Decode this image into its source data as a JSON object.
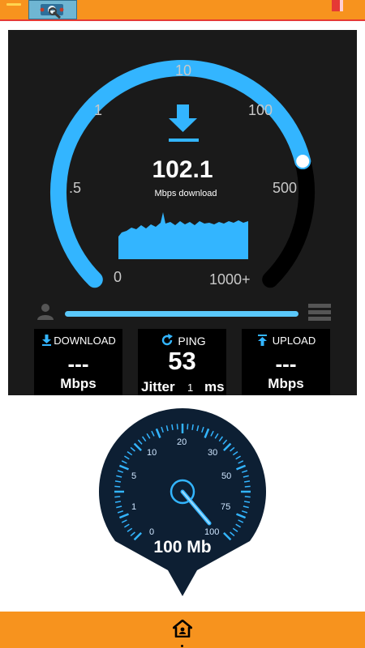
{
  "app": {
    "exit_icon": "exit-door-icon",
    "menu_icon": "menu-icon",
    "logo_icon": "speedtest-logo"
  },
  "colors": {
    "accent_orange": "#f7931e",
    "accent_blue": "#33b5ff",
    "panel_bg": "#1a1a1a",
    "gauge_bg": "#0d1f33"
  },
  "meter": {
    "speed": "102.1",
    "unit_label": "Mbps download",
    "scale_labels": [
      "0",
      ".5",
      "1",
      "10",
      "100",
      "500",
      "1000+"
    ],
    "progress_fraction": 0.78
  },
  "cards": {
    "download": {
      "title": "DOWNLOAD",
      "value": "---",
      "unit": "Mbps"
    },
    "ping": {
      "title": "PING",
      "value": "53",
      "jitter_label": "Jitter",
      "jitter_value": "1",
      "jitter_unit": "ms"
    },
    "upload": {
      "title": "UPLOAD",
      "value": "---",
      "unit": "Mbps"
    }
  },
  "gauge": {
    "labels": [
      "0",
      "1",
      "5",
      "10",
      "20",
      "30",
      "50",
      "75",
      "100"
    ],
    "readout": "100 Mb",
    "needle_value": 100
  },
  "bottom_nav": {
    "home_icon": "home-icon"
  }
}
